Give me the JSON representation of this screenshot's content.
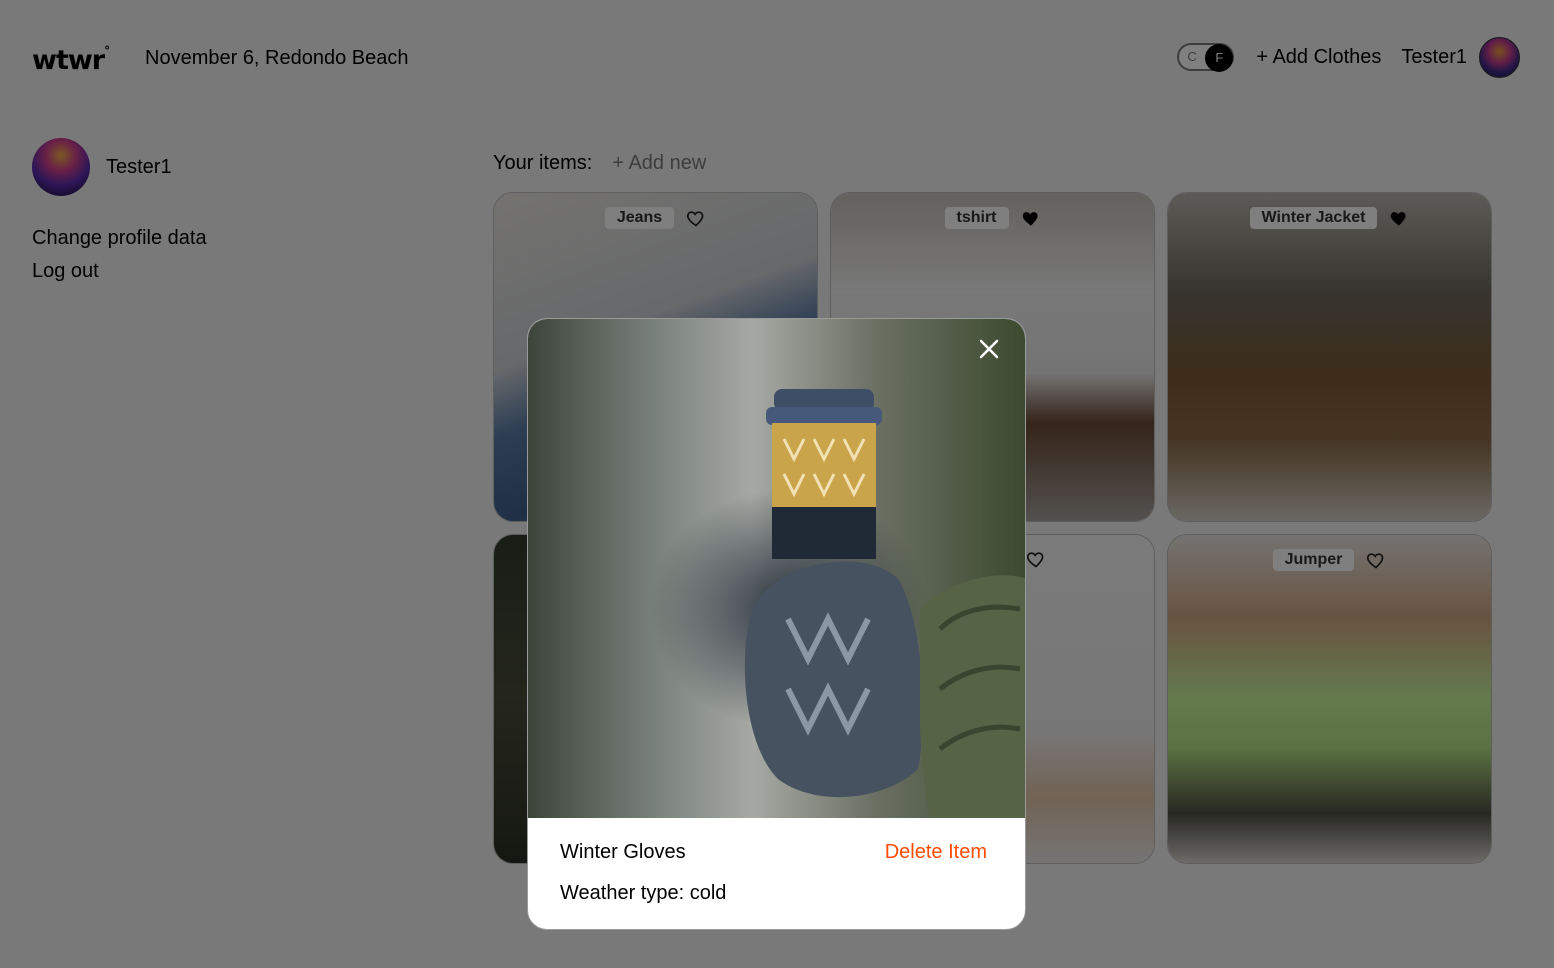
{
  "header": {
    "logo": "wtwr",
    "logo_mark": "°",
    "date_location": "November 6, Redondo Beach",
    "toggle": {
      "option_c": "C",
      "option_f": "F",
      "selected": "F"
    },
    "add_clothes_label": "+ Add Clothes",
    "username": "Tester1"
  },
  "sidebar": {
    "username": "Tester1",
    "links": [
      {
        "label": "Change profile data"
      },
      {
        "label": "Log out"
      }
    ]
  },
  "items": {
    "heading": "Your items:",
    "add_new_label": "+ Add new",
    "cards": [
      {
        "name": "Jeans",
        "liked": false
      },
      {
        "name": "tshirt",
        "liked": true
      },
      {
        "name": "Winter Jacket",
        "liked": true
      },
      {
        "name": "",
        "liked": false
      },
      {
        "name": "",
        "liked": false
      },
      {
        "name": "Jumper",
        "liked": false
      }
    ]
  },
  "modal": {
    "title": "Winter Gloves",
    "delete_label": "Delete Item",
    "weather": "Weather type: cold"
  },
  "colors": {
    "accent_delete": "#ff4d00",
    "overlay": "rgba(0,0,0,0.5)"
  }
}
